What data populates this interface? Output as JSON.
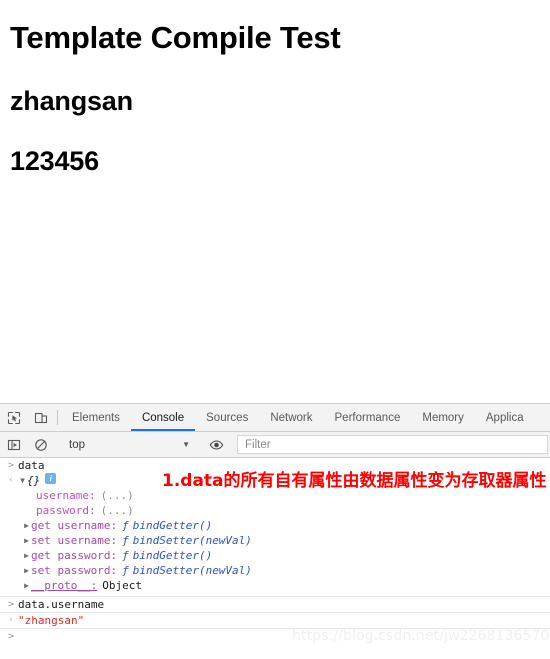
{
  "page": {
    "title": "Template Compile Test",
    "username_line": "zhangsan",
    "password_line": "123456"
  },
  "devtools": {
    "icons": {
      "inspect": "inspect-element-icon",
      "device": "device-toolbar-icon",
      "execute": "execution-context-icon",
      "clear": "clear-console-icon",
      "eye": "live-expression-eye-icon"
    },
    "tabs": [
      {
        "label": "Elements",
        "active": false
      },
      {
        "label": "Console",
        "active": true
      },
      {
        "label": "Sources",
        "active": false
      },
      {
        "label": "Network",
        "active": false
      },
      {
        "label": "Performance",
        "active": false
      },
      {
        "label": "Memory",
        "active": false
      },
      {
        "label": "Applica",
        "active": false
      }
    ],
    "filterbar": {
      "context": "top",
      "caret": "▼",
      "filter_placeholder": "Filter"
    },
    "console": {
      "input_marker": ">",
      "output_marker": "‹",
      "rows": {
        "cmd1": "data",
        "obj_brace": "{}",
        "info_glyph": "i",
        "username_key": "username:",
        "username_val": "(...)",
        "password_key": "password:",
        "password_val": "(...)",
        "get_username_key": "get username:",
        "get_username_fn": "bindGetter()",
        "set_username_key": "set username:",
        "set_username_fn": "bindSetter(newVal)",
        "get_password_key": "get password:",
        "get_password_fn": "bindGetter()",
        "set_password_key": "set password:",
        "set_password_fn": "bindSetter(newVal)",
        "proto_key": "__proto__:",
        "proto_val": "Object",
        "fn_glyph": "ƒ",
        "triangle_collapsed": "▶",
        "triangle_expanded": "▼",
        "cmd2": "data.username",
        "result2": "\"zhangsan\""
      }
    }
  },
  "annotation": {
    "text": "1.data的所有自有属性由数据属性变为存取器属性",
    "color": "#fe0000"
  },
  "watermark": {
    "text": "https://blog.csdn.net/jw2268136570"
  }
}
